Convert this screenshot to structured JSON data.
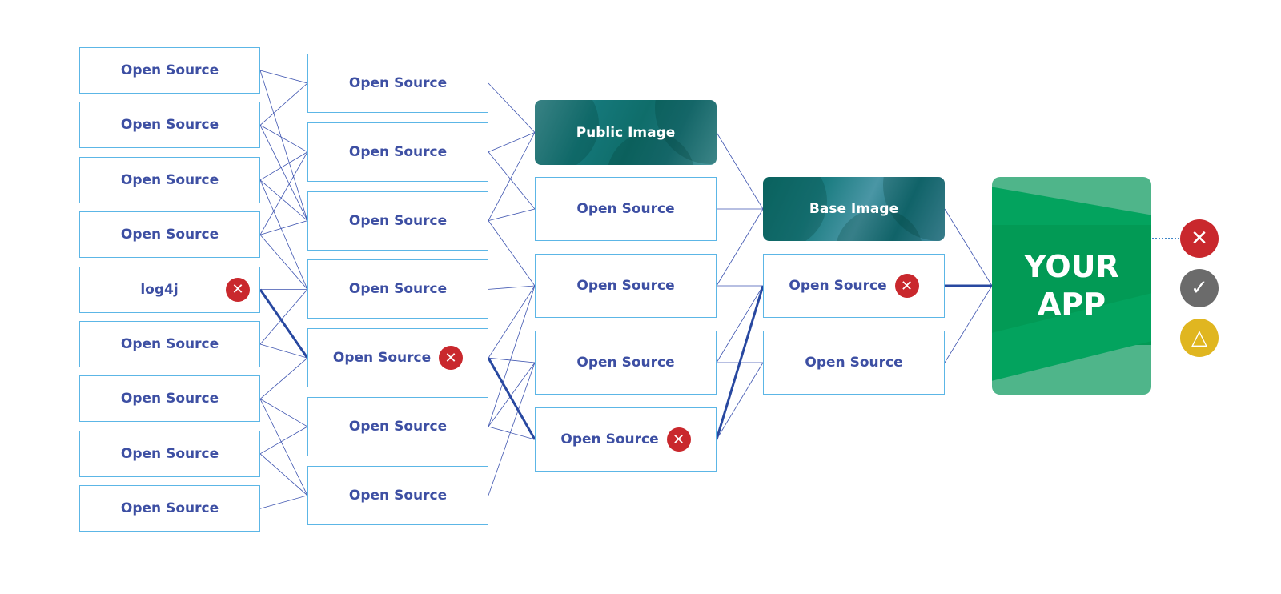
{
  "colors": {
    "box_border": "#5cb6e6",
    "text": "#3d4fa3",
    "edge": "#3f55b0",
    "vulnerable_edge": "#2848a0",
    "error": "#c9282d",
    "ok": "#6b6b6b",
    "warning": "#e0b620",
    "app": "#05a35c"
  },
  "columns": [
    [
      {
        "label": "Open Source"
      },
      {
        "label": "Open Source"
      },
      {
        "label": "Open Source"
      },
      {
        "label": "Open Source"
      },
      {
        "label": "log4j",
        "error": true
      },
      {
        "label": "Open Source"
      },
      {
        "label": "Open Source"
      },
      {
        "label": "Open Source"
      },
      {
        "label": "Open Source"
      }
    ],
    [
      {
        "label": "Open Source"
      },
      {
        "label": "Open Source"
      },
      {
        "label": "Open Source"
      },
      {
        "label": "Open Source"
      },
      {
        "label": "Open Source",
        "error": true
      },
      {
        "label": "Open Source"
      },
      {
        "label": "Open Source"
      }
    ],
    [
      {
        "label": "Public Image",
        "kind": "public-image"
      },
      {
        "label": "Open Source"
      },
      {
        "label": "Open Source"
      },
      {
        "label": "Open Source"
      },
      {
        "label": "Open Source",
        "error": true
      }
    ],
    [
      {
        "label": "Base Image",
        "kind": "base-image"
      },
      {
        "label": "Open Source",
        "error": true
      },
      {
        "label": "Open Source"
      }
    ]
  ],
  "edges": [
    [
      [
        0,
        0
      ],
      [
        0,
        2
      ]
    ],
    [
      [
        1,
        0
      ],
      [
        1,
        1
      ],
      [
        1,
        2
      ]
    ],
    [
      [
        2,
        1
      ],
      [
        2,
        2
      ],
      [
        2,
        3
      ]
    ],
    [
      [
        3,
        1
      ],
      [
        3,
        2
      ],
      [
        3,
        3
      ]
    ],
    [
      [
        4,
        3
      ],
      [
        4,
        4,
        "vuln"
      ]
    ],
    [
      [
        5,
        3
      ],
      [
        5,
        4
      ]
    ],
    [
      [
        6,
        4
      ],
      [
        6,
        5
      ],
      [
        6,
        6
      ]
    ],
    [
      [
        7,
        5
      ],
      [
        7,
        6
      ]
    ],
    [
      [
        8,
        6
      ]
    ]
  ],
  "edges_c2_c3": [
    [
      0,
      0
    ],
    [
      1,
      0
    ],
    [
      1,
      1
    ],
    [
      2,
      0
    ],
    [
      2,
      1
    ],
    [
      2,
      2
    ],
    [
      3,
      2
    ],
    [
      4,
      2
    ],
    [
      4,
      3
    ],
    [
      4,
      4,
      "vuln"
    ],
    [
      5,
      2
    ],
    [
      5,
      3
    ],
    [
      5,
      4
    ],
    [
      6,
      3
    ]
  ],
  "edges_c3_c4": [
    [
      0,
      0
    ],
    [
      1,
      0
    ],
    [
      2,
      0
    ],
    [
      2,
      1
    ],
    [
      3,
      1
    ],
    [
      3,
      2
    ],
    [
      4,
      1,
      "vuln"
    ],
    [
      4,
      2
    ]
  ],
  "edges_c4_app": [
    [
      0
    ],
    [
      1,
      "vuln"
    ],
    [
      2
    ]
  ],
  "app": {
    "line1": "YOUR",
    "line2": "APP"
  },
  "status_icons": [
    {
      "icon": "x-icon",
      "glyph": "✕"
    },
    {
      "icon": "check-icon",
      "glyph": "✓"
    },
    {
      "icon": "warning-triangle-icon",
      "glyph": "△"
    }
  ]
}
